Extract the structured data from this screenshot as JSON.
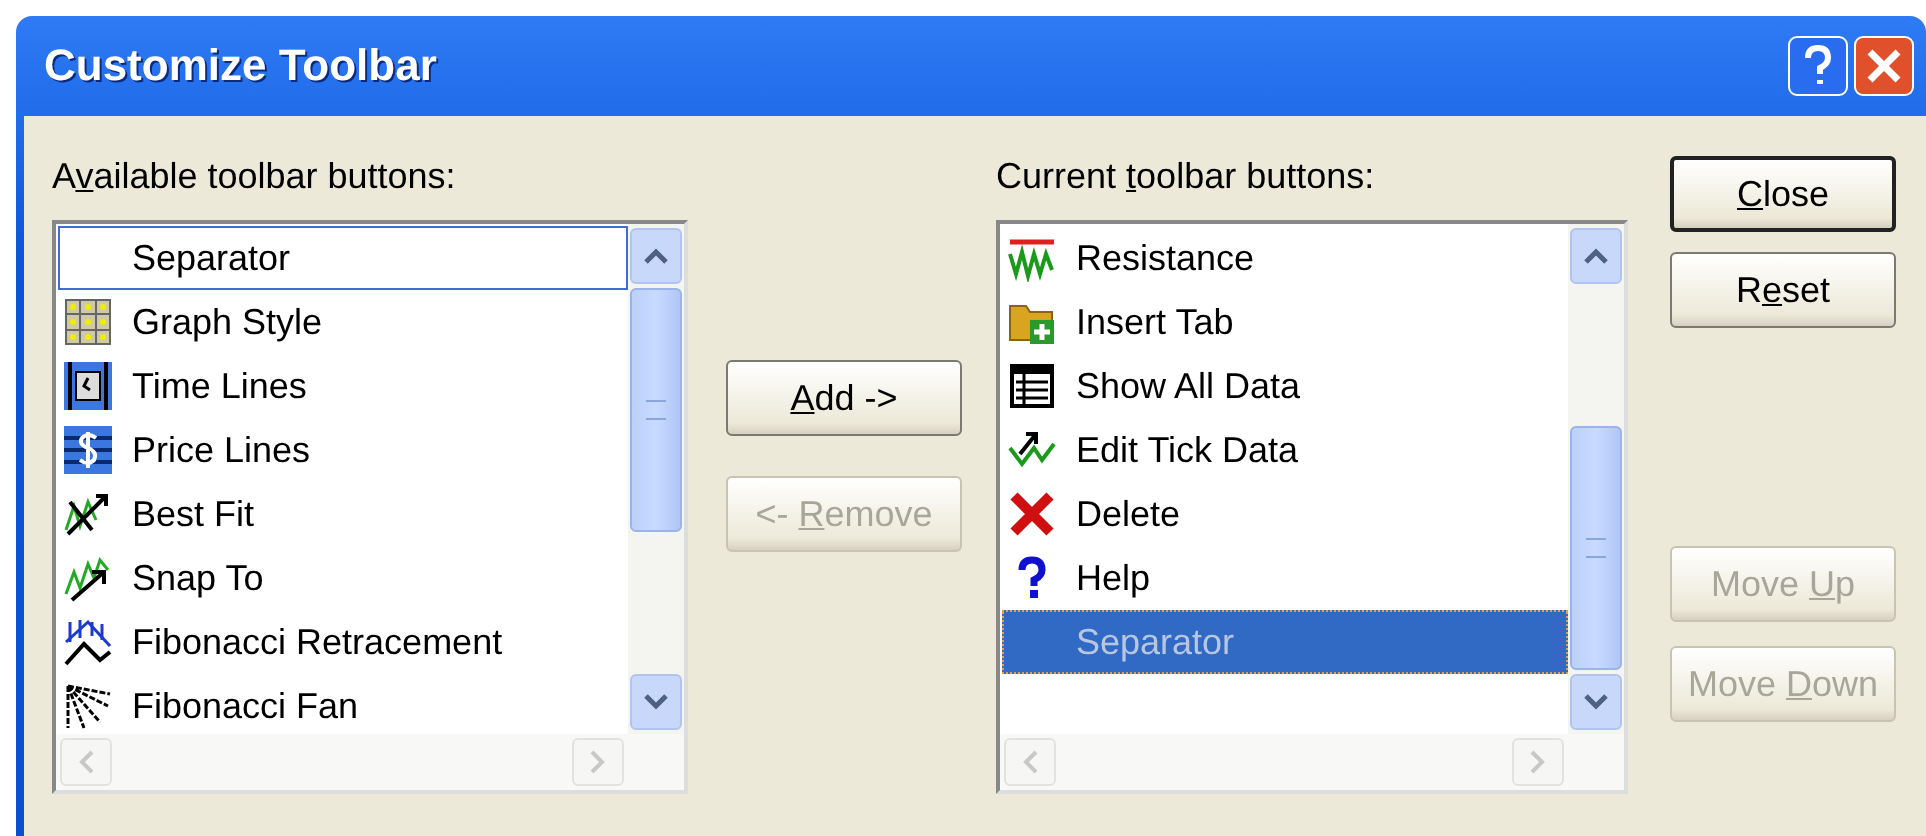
{
  "window": {
    "title": "Customize Toolbar"
  },
  "available": {
    "label": {
      "before": "A",
      "key": "v",
      "after": "ailable toolbar buttons:"
    },
    "items": [
      {
        "text": "Separator",
        "focused": true,
        "selected": false
      },
      {
        "text": "Graph Style",
        "focused": false,
        "selected": false
      },
      {
        "text": "Time Lines",
        "focused": false,
        "selected": false
      },
      {
        "text": "Price Lines",
        "focused": false,
        "selected": false
      },
      {
        "text": "Best Fit",
        "focused": false,
        "selected": false
      },
      {
        "text": "Snap To",
        "focused": false,
        "selected": false
      },
      {
        "text": "Fibonacci Retracement",
        "focused": false,
        "selected": false
      },
      {
        "text": "Fibonacci Fan",
        "focused": false,
        "selected": false
      }
    ]
  },
  "move_buttons": [
    {
      "label": {
        "key": "A",
        "after": "dd ->"
      },
      "disabled": false
    },
    {
      "label": {
        "before": "<- ",
        "key": "R",
        "after": "emove"
      },
      "disabled": true
    }
  ],
  "current": {
    "label": {
      "before": "Current ",
      "key": "t",
      "after": "oolbar buttons:"
    },
    "items": [
      {
        "text": "Resistance",
        "focused": false,
        "selected": false
      },
      {
        "text": "Insert Tab",
        "focused": false,
        "selected": false
      },
      {
        "text": "Show All Data",
        "focused": false,
        "selected": false
      },
      {
        "text": "Edit Tick Data",
        "focused": false,
        "selected": false
      },
      {
        "text": "Delete",
        "focused": false,
        "selected": false
      },
      {
        "text": "Help",
        "focused": false,
        "selected": false
      },
      {
        "text": "Separator",
        "focused": false,
        "selected": true
      }
    ]
  },
  "side_buttons": [
    {
      "label": {
        "key": "C",
        "after": "lose"
      },
      "disabled": false,
      "default": true
    },
    {
      "label": {
        "before": "R",
        "key": "e",
        "after": "set"
      },
      "disabled": false,
      "default": false
    },
    {
      "label": {
        "before": "Move ",
        "key": "U",
        "after": "p"
      },
      "disabled": true,
      "default": false
    },
    {
      "label": {
        "before": "Move ",
        "key": "D",
        "after": "own"
      },
      "disabled": true,
      "default": false
    }
  ]
}
